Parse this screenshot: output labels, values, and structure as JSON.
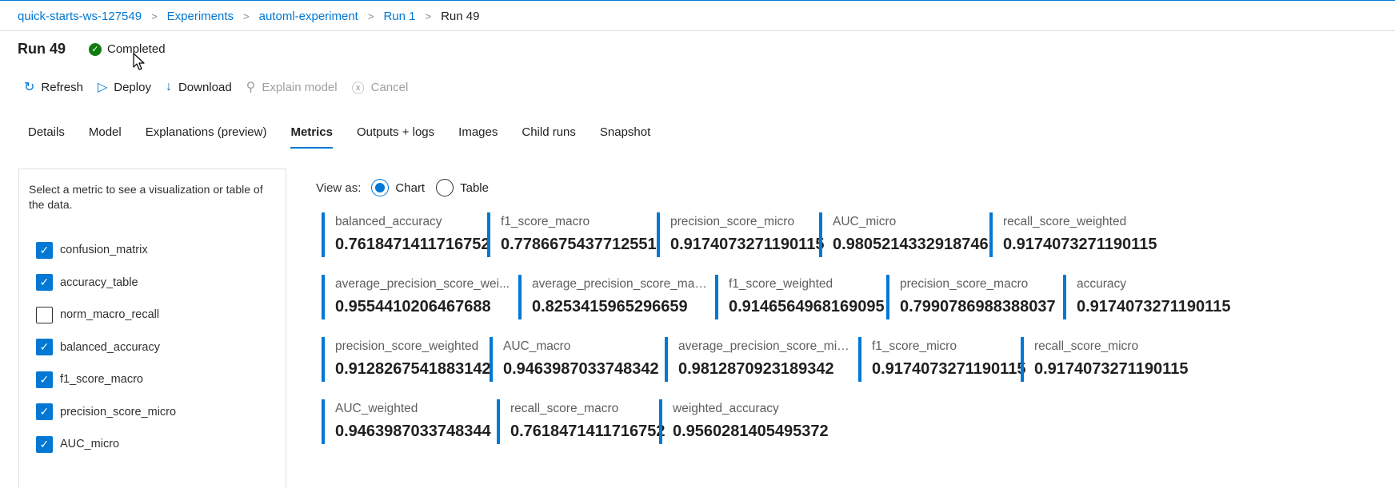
{
  "breadcrumb": {
    "items": [
      "quick-starts-ws-127549",
      "Experiments",
      "automl-experiment",
      "Run 1"
    ],
    "current": "Run 49",
    "separator": ">"
  },
  "run": {
    "title": "Run 49",
    "status": "Completed",
    "status_icon": "check-circle-icon"
  },
  "toolbar": {
    "refresh": "Refresh",
    "deploy": "Deploy",
    "download": "Download",
    "explain_model": "Explain model",
    "cancel": "Cancel"
  },
  "tabs": [
    "Details",
    "Model",
    "Explanations (preview)",
    "Metrics",
    "Outputs + logs",
    "Images",
    "Child runs",
    "Snapshot"
  ],
  "active_tab": "Metrics",
  "metric_panel": {
    "description": "Select a metric to see a visualization or table of the data.",
    "items": [
      {
        "label": "confusion_matrix",
        "checked": true
      },
      {
        "label": "accuracy_table",
        "checked": true
      },
      {
        "label": "norm_macro_recall",
        "checked": false
      },
      {
        "label": "balanced_accuracy",
        "checked": true
      },
      {
        "label": "f1_score_macro",
        "checked": true
      },
      {
        "label": "precision_score_micro",
        "checked": true
      },
      {
        "label": "AUC_micro",
        "checked": true
      }
    ]
  },
  "view_as": {
    "label": "View as:",
    "options": [
      "Chart",
      "Table"
    ],
    "selected": "Chart"
  },
  "metrics": [
    [
      {
        "name": "balanced_accuracy",
        "value": "0.7618471411716752"
      },
      {
        "name": "f1_score_macro",
        "value": "0.7786675437712551"
      },
      {
        "name": "precision_score_micro",
        "value": "0.9174073271190115"
      },
      {
        "name": "AUC_micro",
        "value": "0.9805214332918746"
      },
      {
        "name": "recall_score_weighted",
        "value": "0.9174073271190115"
      }
    ],
    [
      {
        "name": "average_precision_score_wei...",
        "value": "0.9554410206467688"
      },
      {
        "name": "average_precision_score_mac...",
        "value": "0.8253415965296659"
      },
      {
        "name": "f1_score_weighted",
        "value": "0.9146564968169095"
      },
      {
        "name": "precision_score_macro",
        "value": "0.7990786988388037"
      },
      {
        "name": "accuracy",
        "value": "0.9174073271190115"
      }
    ],
    [
      {
        "name": "precision_score_weighted",
        "value": "0.9128267541883142"
      },
      {
        "name": "AUC_macro",
        "value": "0.9463987033748342"
      },
      {
        "name": "average_precision_score_micro",
        "value": "0.9812870923189342"
      },
      {
        "name": "f1_score_micro",
        "value": "0.9174073271190115"
      },
      {
        "name": "recall_score_micro",
        "value": "0.9174073271190115"
      }
    ],
    [
      {
        "name": "AUC_weighted",
        "value": "0.9463987033748344"
      },
      {
        "name": "recall_score_macro",
        "value": "0.7618471411716752"
      },
      {
        "name": "weighted_accuracy",
        "value": "0.9560281405495372"
      }
    ]
  ],
  "colors": {
    "accent": "#0078d4",
    "success": "#107c10",
    "text": "#201f1e",
    "muted": "#605e5c"
  }
}
